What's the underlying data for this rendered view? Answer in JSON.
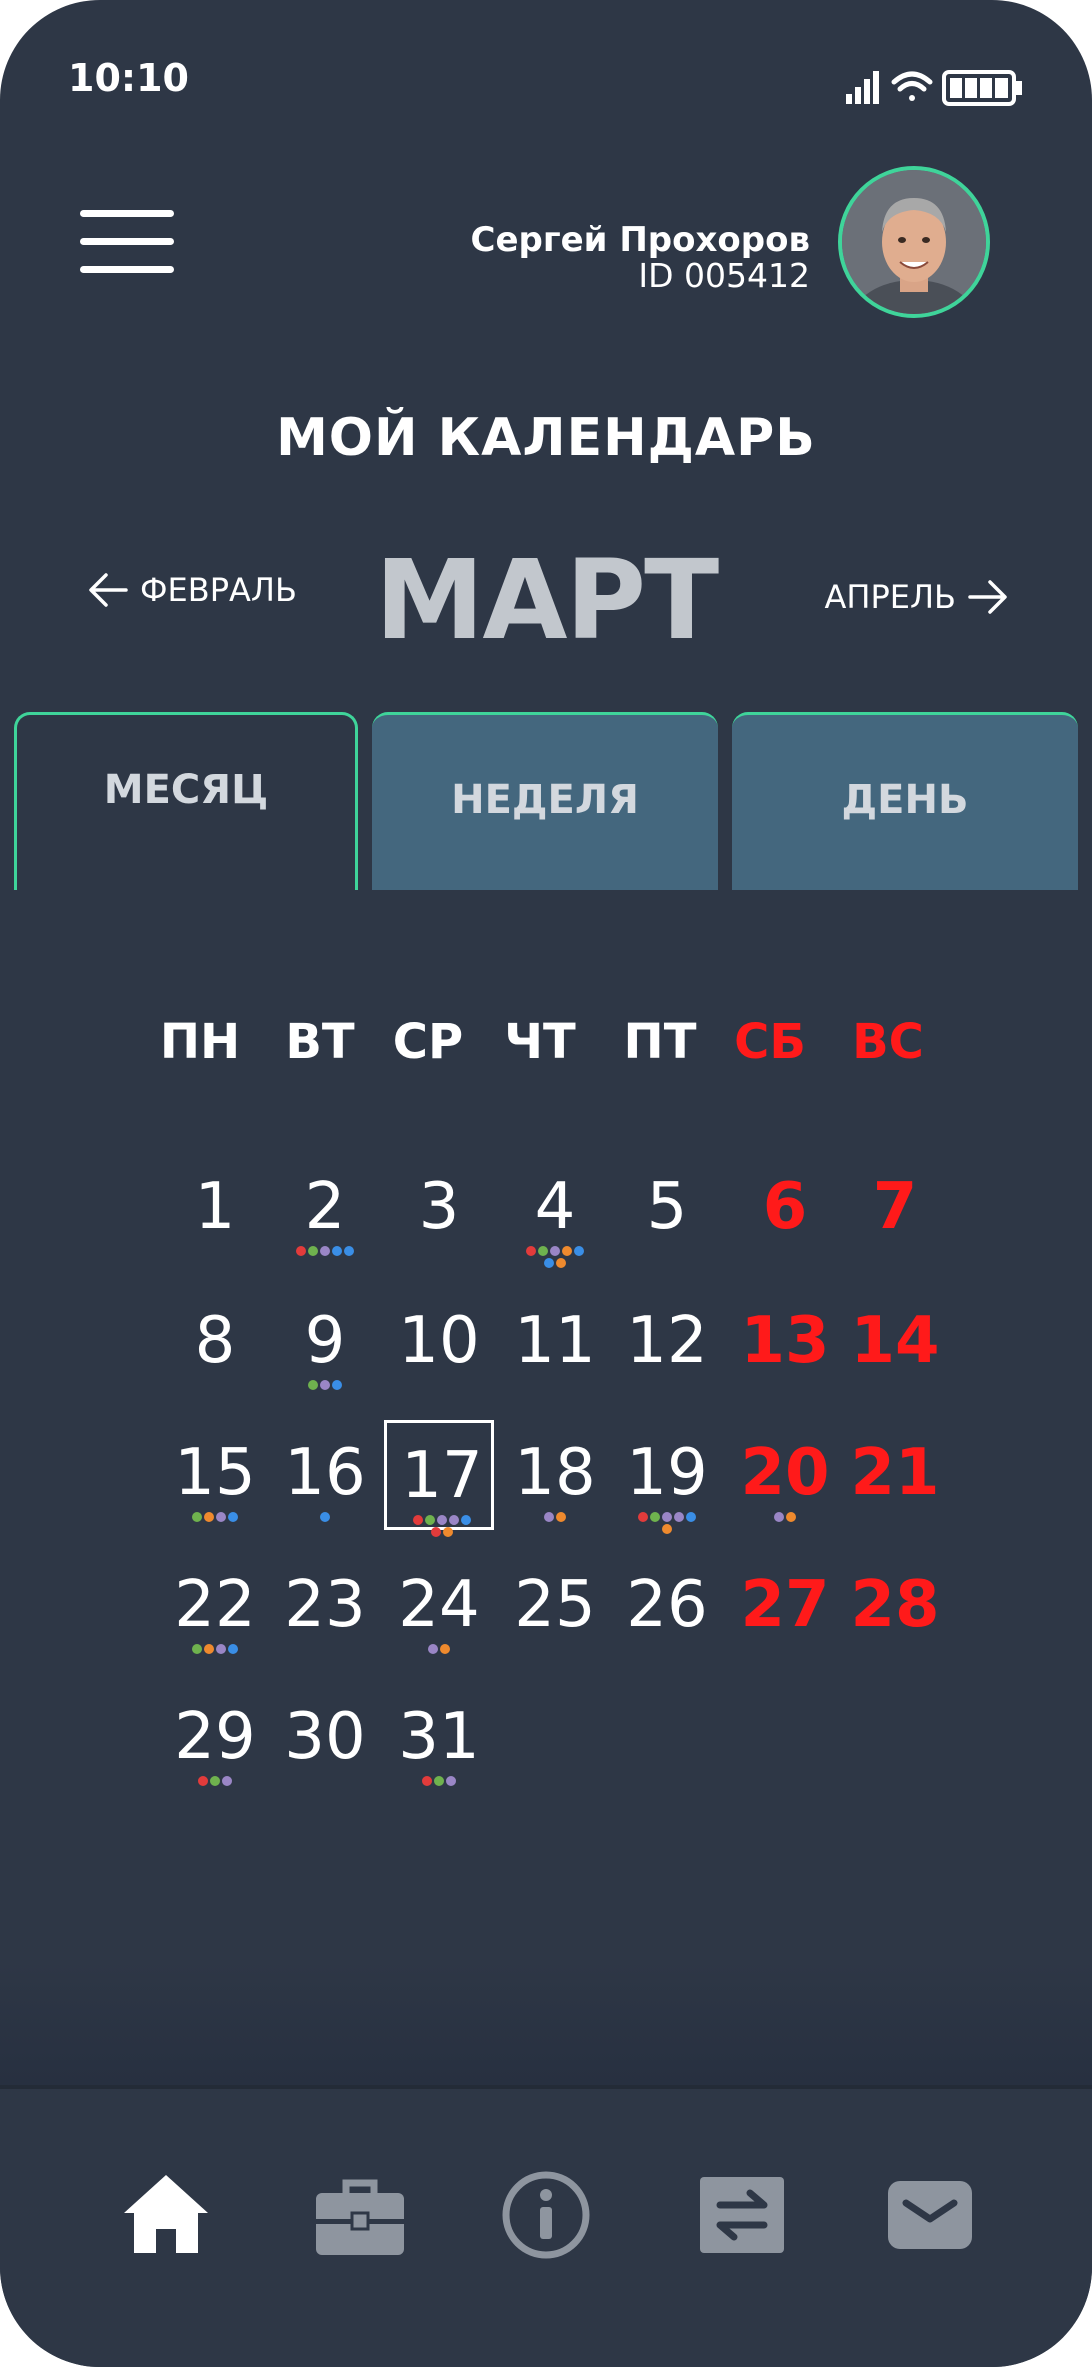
{
  "status_bar": {
    "time": "10:10"
  },
  "header": {
    "user_name": "Сергей Прохоров",
    "user_id": "ID 005412"
  },
  "page_title": "МОЙ КАЛЕНДАРЬ",
  "month_nav": {
    "prev_label": "ФЕВРАЛЬ",
    "current": "МАРТ",
    "next_label": "АПРЕЛЬ"
  },
  "tabs": [
    {
      "label": "МЕСЯЦ",
      "active": true
    },
    {
      "label": "НЕДЕЛЯ",
      "active": false
    },
    {
      "label": "ДЕНЬ",
      "active": false
    }
  ],
  "weekdays": [
    "ПН",
    "ВТ",
    "СР",
    "ЧТ",
    "ПТ",
    "СБ",
    "ВС"
  ],
  "colors": {
    "background": "#2e3746",
    "accent": "#3fd49a",
    "weekend": "#ff1a1a",
    "tab_inactive": "#44677e",
    "event_red": "#e23b3b",
    "event_green": "#6fb24e",
    "event_purple": "#9a86c6",
    "event_blue": "#3a8ee6",
    "event_orange": "#ef8a2e"
  },
  "days": [
    {
      "day": "1",
      "events": []
    },
    {
      "day": "2",
      "events": [
        "red",
        "green",
        "purple",
        "blue",
        "blue"
      ]
    },
    {
      "day": "3",
      "events": []
    },
    {
      "day": "4",
      "events": [
        "red",
        "green",
        "purple",
        "orange",
        "blue",
        "blue",
        "orange"
      ]
    },
    {
      "day": "5",
      "events": []
    },
    {
      "day": "6",
      "events": []
    },
    {
      "day": "7",
      "events": []
    },
    {
      "day": "8",
      "events": []
    },
    {
      "day": "9",
      "events": [
        "green",
        "purple",
        "blue"
      ]
    },
    {
      "day": "10",
      "events": []
    },
    {
      "day": "11",
      "events": []
    },
    {
      "day": "12",
      "events": []
    },
    {
      "day": "13",
      "events": []
    },
    {
      "day": "14",
      "events": []
    },
    {
      "day": "15",
      "events": [
        "green",
        "orange",
        "purple",
        "blue"
      ]
    },
    {
      "day": "16",
      "events": [
        "blue"
      ]
    },
    {
      "day": "17",
      "events": [
        "red",
        "green",
        "purple",
        "purple",
        "blue",
        "red",
        "orange"
      ],
      "today": true
    },
    {
      "day": "18",
      "events": [
        "purple",
        "orange"
      ]
    },
    {
      "day": "19",
      "events": [
        "red",
        "green",
        "purple",
        "purple",
        "blue",
        "orange"
      ]
    },
    {
      "day": "20",
      "events": [
        "purple",
        "orange"
      ]
    },
    {
      "day": "21",
      "events": []
    },
    {
      "day": "22",
      "events": [
        "green",
        "orange",
        "purple",
        "blue"
      ]
    },
    {
      "day": "23",
      "events": []
    },
    {
      "day": "24",
      "events": [
        "purple",
        "orange"
      ]
    },
    {
      "day": "25",
      "events": []
    },
    {
      "day": "26",
      "events": []
    },
    {
      "day": "27",
      "events": []
    },
    {
      "day": "28",
      "events": []
    },
    {
      "day": "29",
      "events": [
        "red",
        "green",
        "purple"
      ]
    },
    {
      "day": "30",
      "events": []
    },
    {
      "day": "31",
      "events": [
        "red",
        "green",
        "purple"
      ]
    }
  ],
  "bottom_nav": [
    {
      "icon": "home-icon",
      "active": true
    },
    {
      "icon": "briefcase-icon",
      "active": false
    },
    {
      "icon": "info-icon",
      "active": false
    },
    {
      "icon": "transfer-icon",
      "active": false
    },
    {
      "icon": "mail-icon",
      "active": false
    }
  ]
}
